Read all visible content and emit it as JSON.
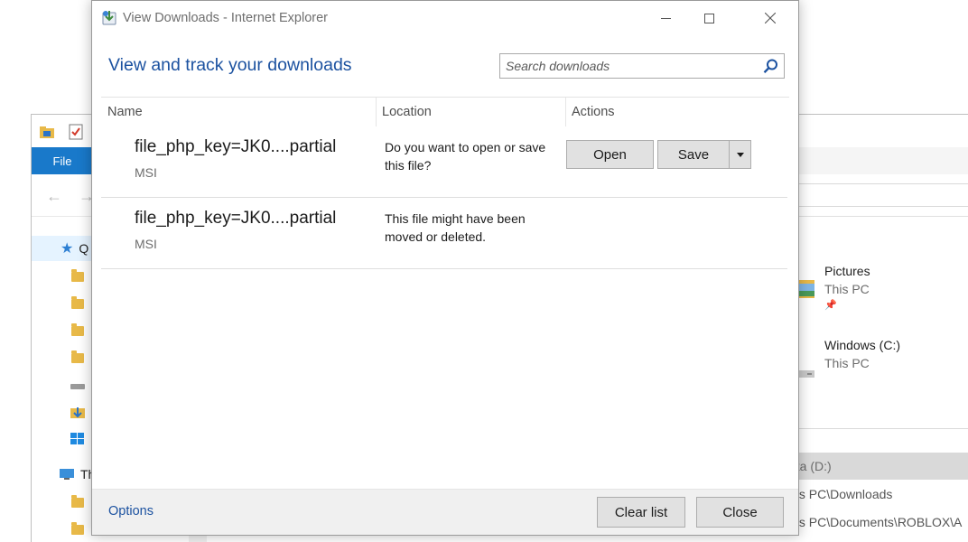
{
  "dialog": {
    "title": "View Downloads - Internet Explorer",
    "heading": "View and track your downloads",
    "search_placeholder": "Search downloads",
    "columns": {
      "name": "Name",
      "location": "Location",
      "actions": "Actions"
    },
    "downloads": [
      {
        "name": "file_php_key=JK0....partial",
        "type": "MSI",
        "location_status": "Do you want to open or save this file?",
        "actions": {
          "open": "Open",
          "save": "Save"
        }
      },
      {
        "name": "file_php_key=JK0....partial",
        "type": "MSI",
        "location_status": "This file might have been moved or deleted."
      }
    ],
    "footer": {
      "options": "Options",
      "clear_list": "Clear list",
      "close": "Close"
    }
  },
  "background_explorer": {
    "file_tab": "File",
    "quick_access_partial": "Q",
    "this_pc_partial": "Th",
    "items": [
      {
        "title": "Pictures",
        "subtitle": "This PC",
        "pinned": true
      },
      {
        "title": "Windows (C:)",
        "subtitle": "This PC"
      }
    ],
    "recent_rows": [
      {
        "text": "ata (D:)",
        "selected": true
      },
      {
        "text": "his PC\\Downloads"
      },
      {
        "text": "his PC\\Documents\\ROBLOX\\A"
      }
    ]
  }
}
